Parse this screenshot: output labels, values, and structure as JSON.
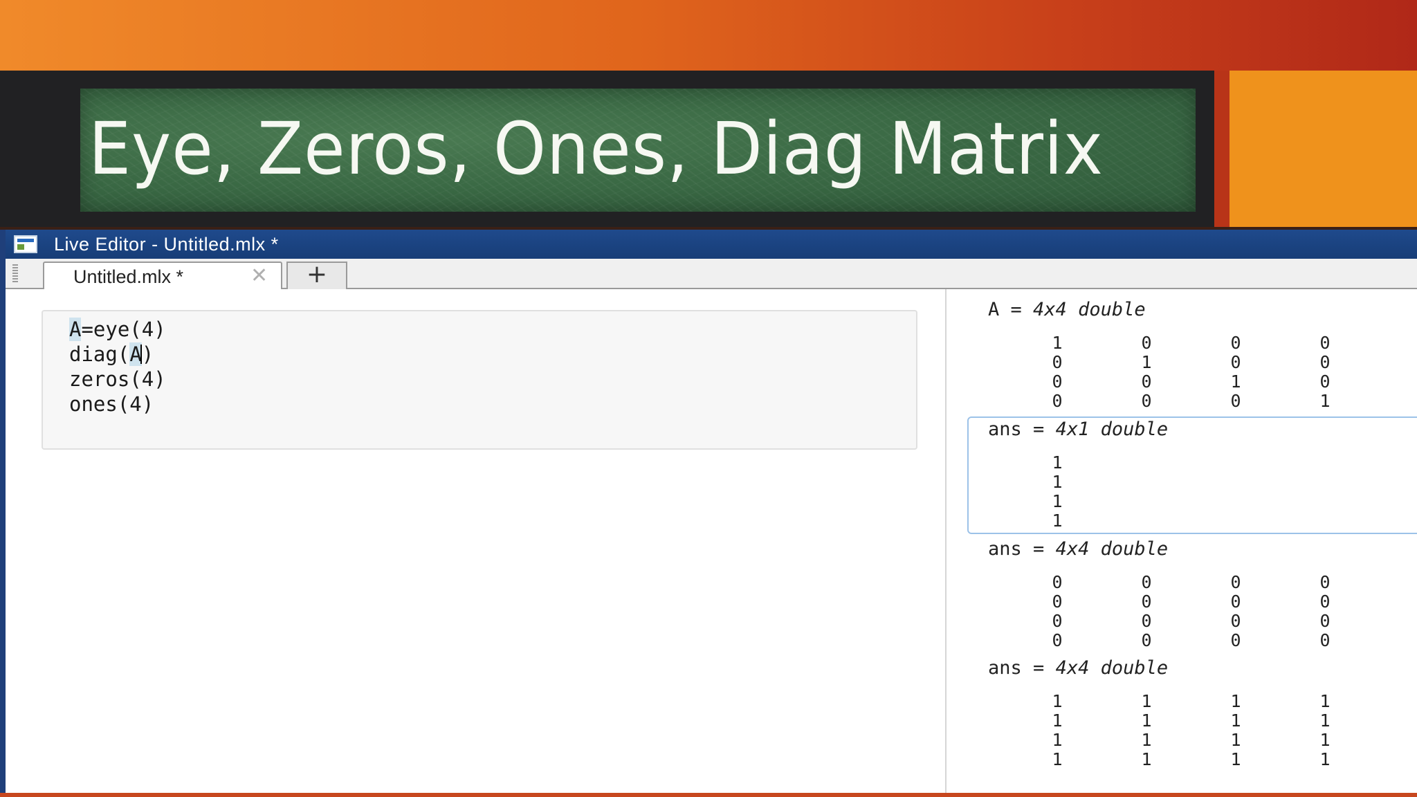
{
  "slide": {
    "title": "Eye, Zeros, Ones, Diag Matrix"
  },
  "window": {
    "title": "Live Editor - Untitled.mlx *"
  },
  "tabs": {
    "active_label": "Untitled.mlx *",
    "close_glyph": "✕",
    "add_glyph": "+"
  },
  "code": {
    "line1": "A=eye(4)",
    "line2": "diag(A)",
    "line3": "zeros(4)",
    "line4": "ones(4)"
  },
  "outputs": [
    {
      "var": "A",
      "eq": "=",
      "desc": "4x4 double",
      "rows": [
        [
          "1",
          "0",
          "0",
          "0"
        ],
        [
          "0",
          "1",
          "0",
          "0"
        ],
        [
          "0",
          "0",
          "1",
          "0"
        ],
        [
          "0",
          "0",
          "0",
          "1"
        ]
      ]
    },
    {
      "var": "ans",
      "eq": "=",
      "desc": "4x1 double",
      "rows": [
        [
          "1"
        ],
        [
          "1"
        ],
        [
          "1"
        ],
        [
          "1"
        ]
      ]
    },
    {
      "var": "ans",
      "eq": "=",
      "desc": "4x4 double",
      "rows": [
        [
          "0",
          "0",
          "0",
          "0"
        ],
        [
          "0",
          "0",
          "0",
          "0"
        ],
        [
          "0",
          "0",
          "0",
          "0"
        ],
        [
          "0",
          "0",
          "0",
          "0"
        ]
      ]
    },
    {
      "var": "ans",
      "eq": "=",
      "desc": "4x4 double",
      "rows": [
        [
          "1",
          "1",
          "1",
          "1"
        ],
        [
          "1",
          "1",
          "1",
          "1"
        ],
        [
          "1",
          "1",
          "1",
          "1"
        ],
        [
          "1",
          "1",
          "1",
          "1"
        ]
      ]
    }
  ]
}
